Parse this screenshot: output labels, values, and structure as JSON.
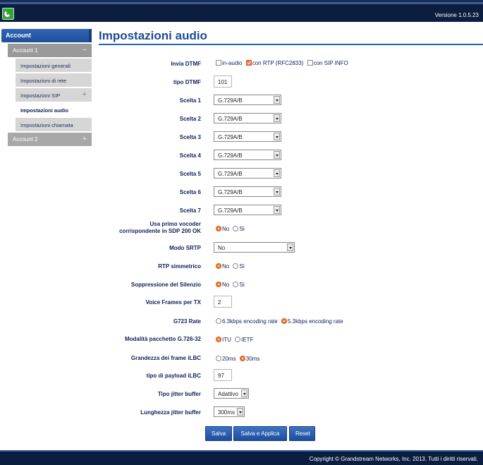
{
  "header": {
    "version": "Versione 1.0.5.23"
  },
  "sidebar": {
    "title": "Account",
    "account1": {
      "label": "Account 1",
      "sign": "−"
    },
    "items": [
      {
        "label": "Impostazioni generali"
      },
      {
        "label": "Impostazioni di rete"
      },
      {
        "label": "Impostazioni SIP",
        "sign": "+"
      },
      {
        "label": "Impostazioni audio"
      },
      {
        "label": "Impostazioni chiamata"
      }
    ],
    "account2": {
      "label": "Account 2",
      "sign": "+"
    }
  },
  "page": {
    "title": "Impostazioni audio"
  },
  "form": {
    "dtmf": {
      "label": "Invia DTMF",
      "options": [
        {
          "label": "in-audio",
          "checked": false
        },
        {
          "label": "con RTP (RFC2833)",
          "checked": true
        },
        {
          "label": "con SIP INFO",
          "checked": false
        }
      ]
    },
    "dtmf_type": {
      "label": "tipo DTMF",
      "value": "101"
    },
    "choices": [
      {
        "label": "Scelta 1",
        "value": "G.729A/B"
      },
      {
        "label": "Scelta 2",
        "value": "G.729A/B"
      },
      {
        "label": "Scelta 3",
        "value": "G.729A/B"
      },
      {
        "label": "Scelta 4",
        "value": "G.729A/B"
      },
      {
        "label": "Scelta 5",
        "value": "G.729A/B"
      },
      {
        "label": "Scelta 6",
        "value": "G.729A/B"
      },
      {
        "label": "Scelta 7",
        "value": "G.729A/B"
      }
    ],
    "first_vocoder": {
      "label_line1": "Usa primo vocoder",
      "label_line2": "corrispondente in SDP 200 OK",
      "options": [
        "No",
        "Sì"
      ],
      "selected": "No"
    },
    "srtp": {
      "label": "Modo SRTP",
      "value": "No"
    },
    "rtp_symmetric": {
      "label": "RTP simmetrico",
      "options": [
        "No",
        "Sì"
      ],
      "selected": "No"
    },
    "silence_suppression": {
      "label": "Soppressione del Silenzio",
      "options": [
        "No",
        "Sì"
      ],
      "selected": "No"
    },
    "voice_frames": {
      "label": "Voice Frames per TX",
      "value": "2"
    },
    "g723_rate": {
      "label": "G723 Rate",
      "options": [
        "6.3kbps encoding rate",
        "5.3kbps encoding rate"
      ],
      "selected": "5.3kbps encoding rate"
    },
    "g726_mode": {
      "label": "Modalità pacchetto G.726-32",
      "options": [
        "ITU",
        "IETF"
      ],
      "selected": "ITU"
    },
    "ilbc_frame": {
      "label": "Grandezza dei frame iLBC",
      "options": [
        "20ms",
        "30ms"
      ],
      "selected": "30ms"
    },
    "ilbc_payload": {
      "label": "tipo di payload iLBC",
      "value": "97"
    },
    "jitter_type": {
      "label": "Tipo jitter buffer",
      "value": "Adattivo"
    },
    "jitter_length": {
      "label": "Lunghezza jitter buffer",
      "value": "300ms"
    }
  },
  "buttons": {
    "save": "Salva",
    "save_apply": "Salva e Applica",
    "reset": "Reset"
  },
  "footer": {
    "copyright": "Copyright © Grandstream Networks, Inc. 2013. Tutti i diritti riservati."
  },
  "colors": {
    "header_bg": "#0b1e40",
    "accent_blue": "#1e4b94",
    "radio_on": "#ef7a38"
  }
}
